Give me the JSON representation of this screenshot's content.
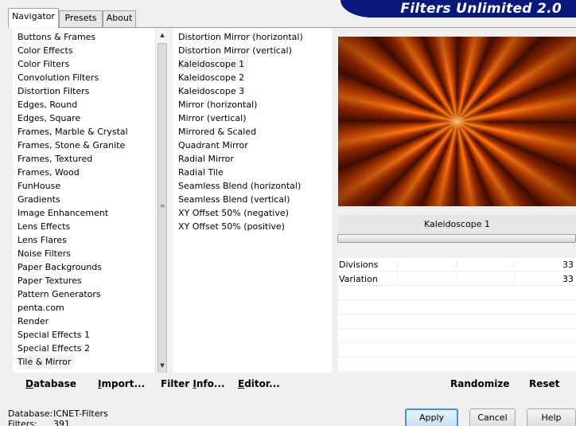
{
  "tabs": [
    {
      "label": "Navigator",
      "active": true
    },
    {
      "label": "Presets",
      "active": false
    },
    {
      "label": "About",
      "active": false
    }
  ],
  "banner": {
    "title": "Filters Unlimited 2.0",
    "color": "#0a1a7c"
  },
  "categories": [
    "Buttons & Frames",
    "Color Effects",
    "Color Filters",
    "Convolution Filters",
    "Distortion Filters",
    "Edges, Round",
    "Edges, Square",
    "Frames, Marble & Crystal",
    "Frames, Stone & Granite",
    "Frames, Textured",
    "Frames, Wood",
    "FunHouse",
    "Gradients",
    "Image Enhancement",
    "Lens Effects",
    "Lens Flares",
    "Noise Filters",
    "Paper Backgrounds",
    "Paper Textures",
    "Pattern Generators",
    "penta.com",
    "Render",
    "Special Effects 1",
    "Special Effects 2",
    "Tile & Mirror"
  ],
  "selected_category": "Tile & Mirror",
  "filters": [
    "Distortion Mirror (horizontal)",
    "Distortion Mirror (vertical)",
    "Kaleidoscope 1",
    "Kaleidoscope 2",
    "Kaleidoscope 3",
    "Mirror (horizontal)",
    "Mirror (vertical)",
    "Mirrored & Scaled",
    "Quadrant Mirror",
    "Radial Mirror",
    "Radial Tile",
    "Seamless Blend (horizontal)",
    "Seamless Blend (vertical)",
    "XY Offset 50% (negative)",
    "XY Offset 50% (positive)"
  ],
  "selected_filter": "Kaleidoscope 1",
  "preview": {
    "icon": "kaleidoscope-preview-image"
  },
  "filter_name": "Kaleidoscope 1",
  "params": [
    {
      "label": "Divisions",
      "value": "33"
    },
    {
      "label": "Variation",
      "value": "33"
    }
  ],
  "actions_left": {
    "database": {
      "pre": "",
      "u": "D",
      "post": "atabase"
    },
    "import": {
      "pre": "",
      "u": "I",
      "post": "mport..."
    },
    "filter_info": {
      "pre": "Filter ",
      "u": "I",
      "post": "nfo..."
    },
    "editor": {
      "pre": "",
      "u": "E",
      "post": "ditor..."
    }
  },
  "actions_right": {
    "randomize": "Randomize",
    "reset": "Reset"
  },
  "footer": {
    "database_label": "Database:",
    "database_value": "ICNET-Filters",
    "filters_label": "Filters:",
    "filters_value": "391"
  },
  "buttons": {
    "apply": "Apply",
    "cancel": "Cancel",
    "help": "Help"
  },
  "colors": {
    "accent": "#4a90d9",
    "selection": "#f3f3f3"
  }
}
